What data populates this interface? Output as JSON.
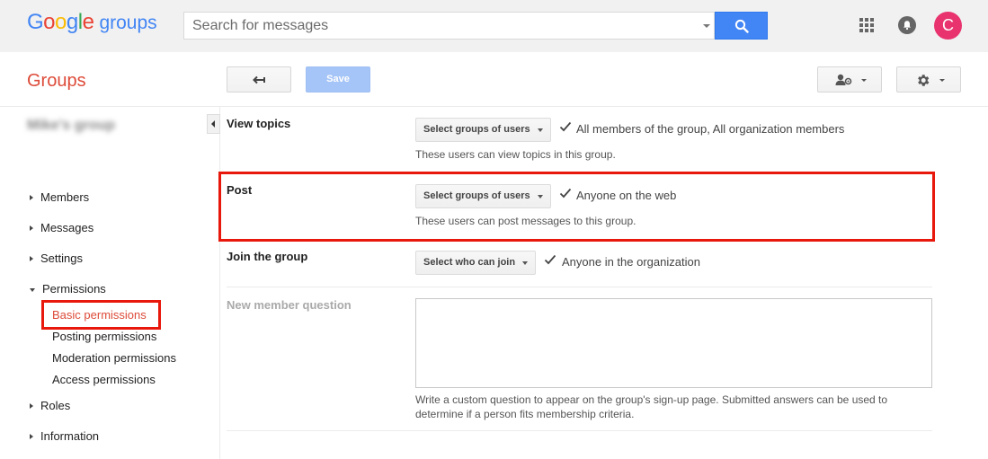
{
  "header": {
    "logo": {
      "letters": [
        "G",
        "o",
        "o",
        "g",
        "l",
        "e"
      ],
      "product": "groups"
    },
    "search": {
      "placeholder": "Search for messages",
      "value": ""
    },
    "avatar_initial": "C",
    "icons": {
      "search": "search-icon",
      "apps": "apps-grid-icon",
      "notifications": "bell-icon"
    }
  },
  "toolbar": {
    "section_title": "Groups",
    "save_label": "Save",
    "icons": {
      "back": "back-arrow-icon",
      "members": "add-member-icon",
      "settings": "gear-icon"
    }
  },
  "sidebar": {
    "group_name": "Mike's group",
    "nav": [
      {
        "label": "Members",
        "expanded": false
      },
      {
        "label": "Messages",
        "expanded": false
      },
      {
        "label": "Settings",
        "expanded": false
      },
      {
        "label": "Permissions",
        "expanded": true
      },
      {
        "label": "Roles",
        "expanded": false
      },
      {
        "label": "Information",
        "expanded": false
      }
    ],
    "permissions_sub": [
      {
        "label": "Basic permissions",
        "active": true
      },
      {
        "label": "Posting permissions",
        "active": false
      },
      {
        "label": "Moderation permissions",
        "active": false
      },
      {
        "label": "Access permissions",
        "active": false
      }
    ]
  },
  "permissions": [
    {
      "label": "View topics",
      "select_label": "Select groups of users",
      "value": "All members of the group, All organization members",
      "help": "These users can view topics in this group."
    },
    {
      "label": "Post",
      "select_label": "Select groups of users",
      "value": "Anyone on the web",
      "help": "These users can post messages to this group."
    },
    {
      "label": "Join the group",
      "select_label": "Select who can join",
      "value": "Anyone in the organization"
    }
  ],
  "new_member_question": {
    "label": "New member question",
    "value": "",
    "description": "Write a custom question to appear on the group's sign-up page. Submitted answers can be used to determine if a person fits membership criteria."
  },
  "colors": {
    "accent_red": "#dd4b39",
    "highlight_box": "#e8180c",
    "search_blue": "#4285f4",
    "avatar": "#e8336e"
  }
}
